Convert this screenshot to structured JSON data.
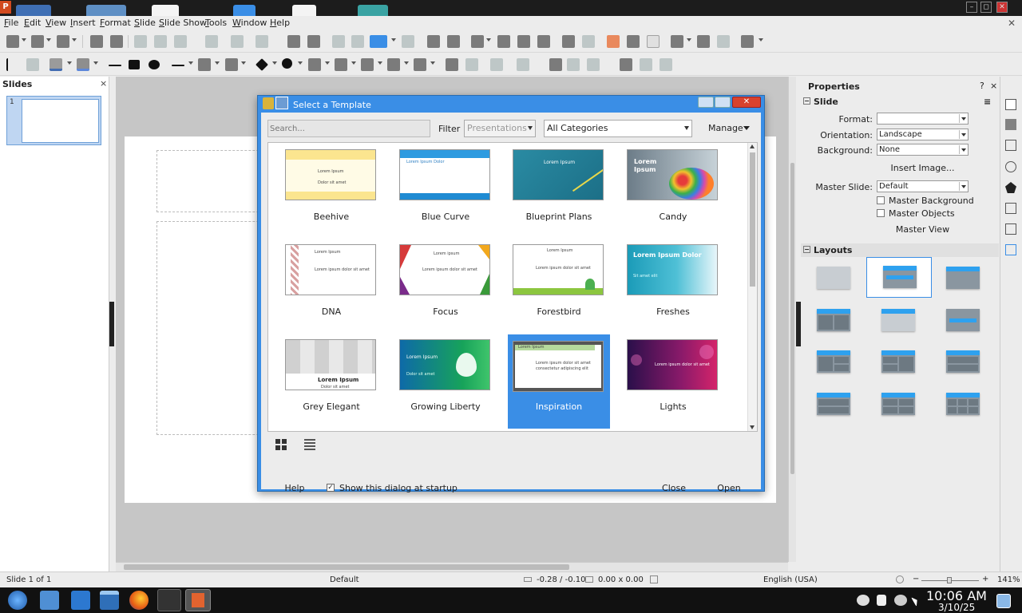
{
  "window": {
    "app_logo": "P",
    "controls": [
      "–",
      "◻",
      "✕"
    ]
  },
  "menubar": {
    "items": [
      "File",
      "Edit",
      "View",
      "Insert",
      "Format",
      "Slide",
      "Slide Show",
      "Tools",
      "Window",
      "Help"
    ],
    "close": "✕"
  },
  "slides_panel": {
    "title": "Slides",
    "close": "×",
    "thumb_number": "1"
  },
  "properties": {
    "title": "Properties",
    "help": "?",
    "close": "×",
    "slide_section": "Slide",
    "format_label": "Format:",
    "format_value": "",
    "orientation_label": "Orientation:",
    "orientation_value": "Landscape",
    "background_label": "Background:",
    "background_value": "None",
    "insert_image": "Insert Image...",
    "master_slide_label": "Master Slide:",
    "master_slide_value": "Default",
    "master_background": "Master Background",
    "master_objects": "Master Objects",
    "master_view": "Master View",
    "layouts_section": "Layouts"
  },
  "statusbar": {
    "slide_pos": "Slide 1 of 1",
    "master": "Default",
    "position": "-0.28 / -0.10",
    "size": "0.00 x 0.00",
    "language": "English (USA)",
    "zoom": "141%"
  },
  "taskbar": {
    "time": "10:06 AM",
    "date": "3/10/25"
  },
  "dialog": {
    "title": "Select a Template",
    "search_placeholder": "Search...",
    "filter_label": "Filter",
    "filter_value": "Presentations",
    "category_value": "All Categories",
    "manage": "Manage",
    "templates": [
      {
        "name": "Beehive",
        "line1": "Lorem Ipsum",
        "line2": "Dolor sit amet"
      },
      {
        "name": "Blue Curve",
        "line1": "Lorem Ipsum Dolor",
        "line2": ""
      },
      {
        "name": "Blueprint Plans",
        "line1": "Lorem Ipsum",
        "line2": ""
      },
      {
        "name": "Candy",
        "line1": "Lorem",
        "line2": "Ipsum"
      },
      {
        "name": "DNA",
        "line1": "Lorem Ipsum",
        "line2": "Lorem ipsum dolor sit amet"
      },
      {
        "name": "Focus",
        "line1": "Lorem ipsum",
        "line2": "Lorem ipsum dolor sit amet"
      },
      {
        "name": "Forestbird",
        "line1": "Lorem Ipsum",
        "line2": "Lorem ipsum dolor sit amet"
      },
      {
        "name": "Freshes",
        "line1": "Lorem Ipsum Dolor",
        "line2": "Sit amet elit"
      },
      {
        "name": "Grey Elegant",
        "line1": "Lorem Ipsum",
        "line2": "Dolor sit amet"
      },
      {
        "name": "Growing Liberty",
        "line1": "Lorem Ipsum",
        "line2": "Dolor sit amet"
      },
      {
        "name": "Inspiration",
        "line1": "Lorem ipsum dolor sit amet",
        "line2": "consectetur adipiscing elit"
      },
      {
        "name": "Lights",
        "line1": "Lorem ipsum dolor sit amet",
        "line2": ""
      }
    ],
    "help": "Help",
    "show_at_startup": "Show this dialog at startup",
    "startup_checked": "✓",
    "close": "Close",
    "open": "Open",
    "close_x": "✕"
  },
  "colors": {
    "accent": "#3a8ee6",
    "selected_template": "#3a8ee6"
  }
}
